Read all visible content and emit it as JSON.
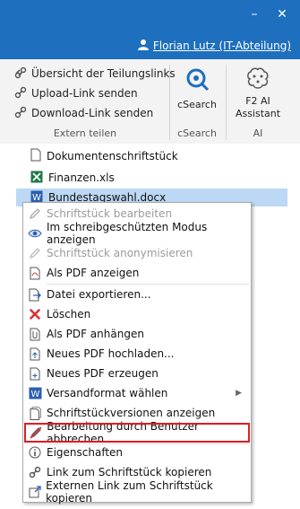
{
  "window": {
    "minimize_glyph": "–",
    "close_glyph": "✕",
    "colors": {
      "titlebar": "#1e6fbd",
      "highlight_border": "#e11b22",
      "selection": "#bcd8f4"
    }
  },
  "user": {
    "name": "Florian Lutz (IT-Abteilung)",
    "icon": "user-icon"
  },
  "ribbon": {
    "extern_teilen": {
      "items": [
        {
          "label": "Übersicht der Teilungslinks",
          "icon": "link-overview-icon"
        },
        {
          "label": "Upload-Link senden",
          "icon": "upload-link-icon"
        },
        {
          "label": "Download-Link senden",
          "icon": "download-link-icon"
        }
      ],
      "group_label": "Extern teilen"
    },
    "csearch": {
      "label": "cSearch",
      "group_label": "cSearch",
      "icon": "csearch-icon"
    },
    "ai": {
      "label_line1": "F2 AI",
      "label_line2": "Assistant",
      "group_label": "AI",
      "icon": "brain-icon"
    }
  },
  "tree": {
    "items": [
      {
        "label": "Dokumentenschriftstück",
        "icon": "document-icon"
      },
      {
        "label": "Finanzen.xls",
        "icon": "excel-file-icon"
      },
      {
        "label": "Bundestagswahl.docx",
        "icon": "word-file-icon",
        "selected": true
      }
    ]
  },
  "context_menu": {
    "items": [
      {
        "label": "Schriftstück bearbeiten",
        "icon": "pencil-icon",
        "disabled": true
      },
      {
        "label": "Im schreibgeschützten Modus anzeigen",
        "icon": "eye-icon"
      },
      {
        "label": "Schriftstück anonymisieren",
        "icon": "anonymize-icon",
        "disabled": true
      },
      {
        "label": "Als PDF anzeigen",
        "icon": "pdf-icon"
      },
      {
        "label": "Datei exportieren...",
        "icon": "export-icon"
      },
      {
        "label": "Löschen",
        "icon": "delete-icon"
      },
      {
        "label": "Als PDF anhängen",
        "icon": "attach-icon"
      },
      {
        "label": "Neues PDF hochladen...",
        "icon": "pdf-upload-icon"
      },
      {
        "label": "Neues PDF erzeugen",
        "icon": "pdf-create-icon"
      },
      {
        "label": "Versandformat wählen",
        "icon": "word-icon",
        "submenu": true
      },
      {
        "label": "Schriftstückversionen anzeigen",
        "icon": "versions-icon"
      },
      {
        "label": "Bearbeitung durch Benutzer abbrechen",
        "icon": "cancel-edit-icon",
        "highlighted": true
      },
      {
        "label": "Eigenschaften",
        "icon": "info-icon"
      },
      {
        "label": "Link zum Schriftstück kopieren",
        "icon": "link-icon"
      },
      {
        "label": "Externen Link zum Schriftstück kopieren",
        "icon": "external-link-icon"
      }
    ],
    "submenu_glyph": "▶"
  }
}
